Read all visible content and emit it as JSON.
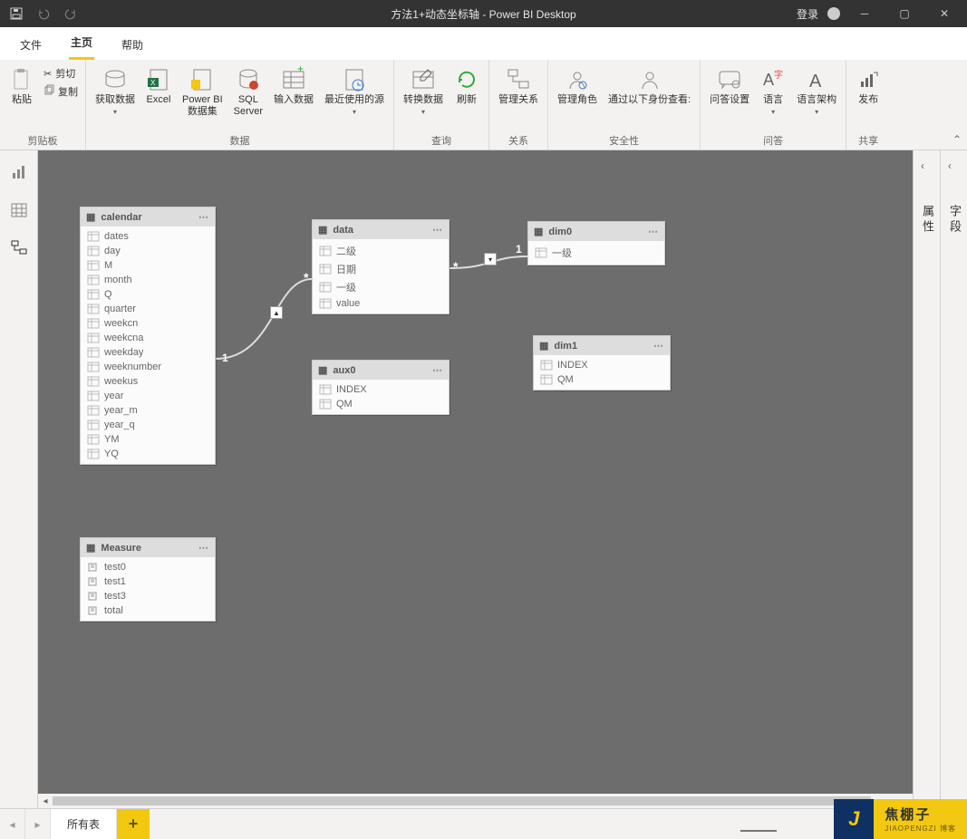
{
  "titlebar": {
    "title": "方法1+动态坐标轴 - Power BI Desktop",
    "login": "登录"
  },
  "menubar": {
    "file": "文件",
    "home": "主页",
    "help": "帮助"
  },
  "ribbon": {
    "clipboard": {
      "label": "剪贴板",
      "paste": "粘贴",
      "cut": "剪切",
      "copy": "复制"
    },
    "data": {
      "label": "数据",
      "getdata": "获取数据",
      "excel": "Excel",
      "pbids": "Power BI\n数据集",
      "sql": "SQL\nServer",
      "enter": "输入数据",
      "recent": "最近使用的源"
    },
    "query": {
      "label": "查询",
      "transform": "转换数据",
      "refresh": "刷新"
    },
    "relationship": {
      "label": "关系",
      "manage": "管理关系"
    },
    "security": {
      "label": "安全性",
      "roles": "管理角色",
      "viewas": "通过以下身份查看:"
    },
    "qa": {
      "label": "问答",
      "settings": "问答设置",
      "lang": "语言",
      "schema": "语言架构"
    },
    "share": {
      "label": "共享",
      "publish": "发布"
    }
  },
  "rightRails": {
    "properties": "属性",
    "fields": "字段"
  },
  "tables": {
    "calendar": {
      "name": "calendar",
      "fields": [
        "dates",
        "day",
        "M",
        "month",
        "Q",
        "quarter",
        "weekcn",
        "weekcna",
        "weekday",
        "weeknumber",
        "weekus",
        "year",
        "year_m",
        "year_q",
        "YM",
        "YQ"
      ]
    },
    "measure": {
      "name": "Measure",
      "fields": [
        "test0",
        "test1",
        "test3",
        "total"
      ]
    },
    "data": {
      "name": "data",
      "fields": [
        "二级",
        "日期",
        "一级",
        "value"
      ]
    },
    "aux0": {
      "name": "aux0",
      "fields": [
        "INDEX",
        "QM"
      ]
    },
    "dim0": {
      "name": "dim0",
      "fields": [
        "一级"
      ]
    },
    "dim1": {
      "name": "dim1",
      "fields": [
        "INDEX",
        "QM"
      ]
    }
  },
  "sheetbar": {
    "allTables": "所有表"
  },
  "watermark": {
    "letter": "J",
    "big": "焦棚子",
    "small": "JIAOPENGZI 博客"
  }
}
